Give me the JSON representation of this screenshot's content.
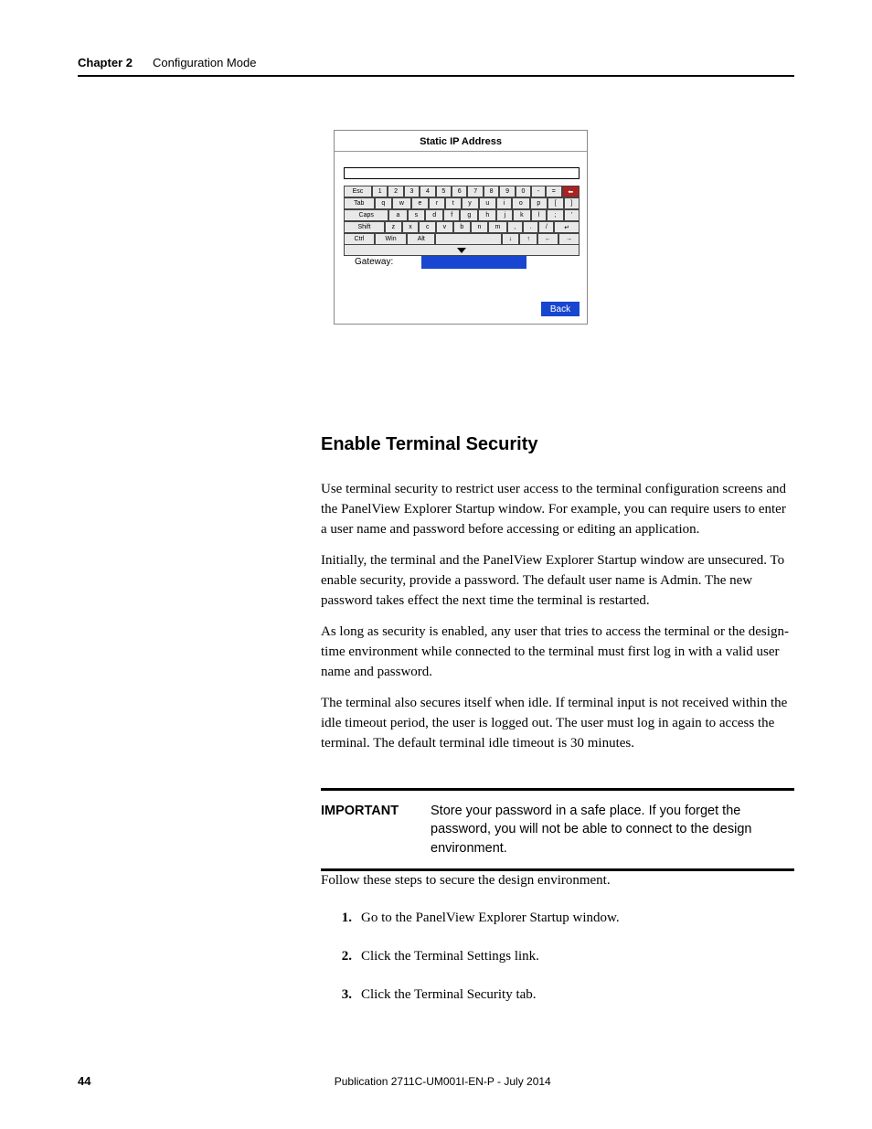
{
  "header": {
    "chapter_label": "Chapter 2",
    "chapter_title": "Configuration Mode"
  },
  "figure": {
    "title": "Static IP Address",
    "gateway_label": "Gateway:",
    "back_label": "Back",
    "keyboard": {
      "row1": [
        "Esc",
        "1",
        "2",
        "3",
        "4",
        "5",
        "6",
        "7",
        "8",
        "9",
        "0",
        "-",
        "=",
        "⬅"
      ],
      "row2": [
        "Tab",
        "q",
        "w",
        "e",
        "r",
        "t",
        "y",
        "u",
        "i",
        "o",
        "p",
        "[",
        "]"
      ],
      "row3": [
        "Caps",
        "a",
        "s",
        "d",
        "f",
        "g",
        "h",
        "j",
        "k",
        "l",
        ";",
        "'"
      ],
      "row4": [
        "Shift",
        "z",
        "x",
        "c",
        "v",
        "b",
        "n",
        "m",
        ",",
        ".",
        "/",
        "↵"
      ],
      "row5": [
        "Ctrl",
        "Win",
        "Alt",
        "",
        "↓",
        "↑",
        "←",
        "→"
      ]
    }
  },
  "section": {
    "heading": "Enable Terminal Security",
    "para1": "Use terminal security to restrict user access to the terminal configuration screens and the PanelView Explorer Startup window. For example, you can require users to enter a user name and password before accessing or editing an application.",
    "para2": "Initially, the terminal and the PanelView Explorer Startup window are unsecured. To enable security, provide a password. The default user name is Admin. The new password takes effect the next time the terminal is restarted.",
    "para3": "As long as security is enabled, any user that tries to access the terminal or the design-time environment while connected to the terminal must first log in with a valid user name and password.",
    "para4": "The terminal also secures itself when idle. If terminal input is not received within the idle timeout period, the user is logged out. The user must log in again to access the terminal. The default terminal idle timeout is 30 minutes."
  },
  "callout": {
    "label": "IMPORTANT",
    "text": "Store your password in a safe place. If you forget the password, you will not be able to connect to the design environment."
  },
  "steps": {
    "intro": "Follow these steps to secure the design environment.",
    "items": [
      {
        "num": "1.",
        "text": "Go to the PanelView Explorer Startup window."
      },
      {
        "num": "2.",
        "text": "Click the Terminal Settings link."
      },
      {
        "num": "3.",
        "text": "Click the Terminal Security tab."
      }
    ]
  },
  "footer": {
    "page_number": "44",
    "publication": "Publication 2711C-UM001I-EN-P - July 2014"
  }
}
